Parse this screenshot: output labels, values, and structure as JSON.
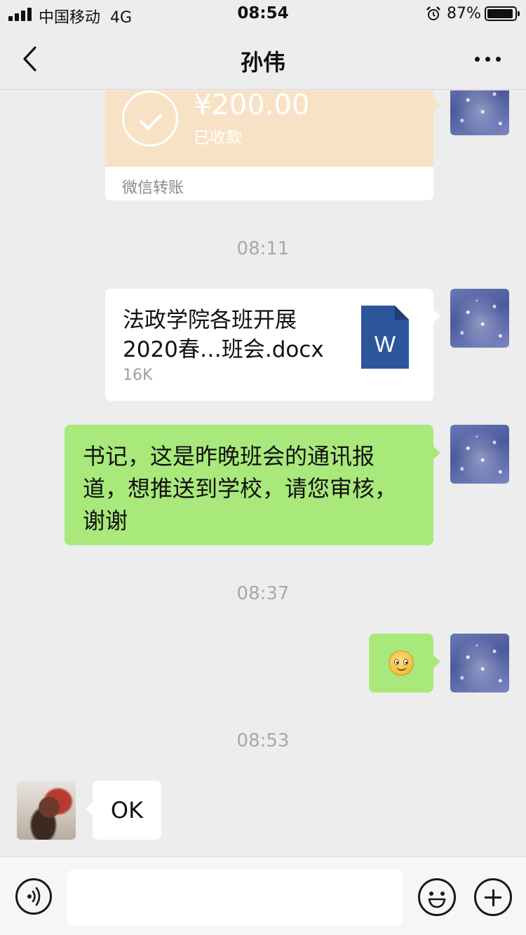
{
  "status_bar": {
    "carrier": "中国移动",
    "network": "4G",
    "time": "08:54",
    "battery_percent": "87%",
    "battery_level": 0.87,
    "icons": [
      "signal-icon",
      "alarm-icon",
      "battery-icon"
    ]
  },
  "nav": {
    "title": "孙伟",
    "back_icon": "chevron-left-icon",
    "more_icon": "more-icon"
  },
  "messages": {
    "transfer": {
      "amount": "¥200.00",
      "status": "已收款",
      "footer": "微信转账"
    },
    "timestamp_1": "08:11",
    "file": {
      "name": "法政学院各班开展2020春…班会.docx",
      "size": "16K",
      "icon_letter": "W"
    },
    "text_1": "书记，这是昨晚班会的通讯报道，想推送到学校，请您审核，谢谢",
    "timestamp_2": "08:37",
    "emoji": "smiley",
    "timestamp_3": "08:53",
    "reply": "OK"
  },
  "input_bar": {
    "placeholder": "",
    "icons": [
      "voice-icon",
      "emoji-icon",
      "plus-icon"
    ]
  },
  "colors": {
    "background": "#ededed",
    "bubble_green": "#a9e97b",
    "transfer_orange": "#f8e2c5",
    "word_blue": "#2b579a"
  }
}
